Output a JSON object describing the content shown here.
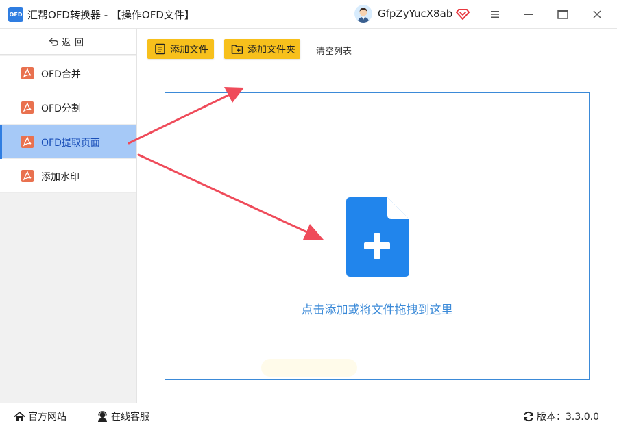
{
  "window": {
    "logo_text": "OFD",
    "title": "汇帮OFD转换器 - 【操作OFD文件】",
    "user_name": "GfpZyYucX8ab"
  },
  "colors": {
    "accent": "#2f7de1",
    "active_nav_bg": "#a6c9f7",
    "toolbar_button": "#f7c01c",
    "dropzone_border": "#3b8ad8",
    "arrow": "#ef4b5a",
    "nav_icon": "#e9714f"
  },
  "sidebar": {
    "back_label": "返回",
    "items": [
      {
        "label": "OFD合并",
        "icon": "pdf-icon",
        "active": false
      },
      {
        "label": "OFD分割",
        "icon": "pdf-icon",
        "active": false
      },
      {
        "label": "OFD提取页面",
        "icon": "pdf-icon",
        "active": true
      },
      {
        "label": "添加水印",
        "icon": "pdf-icon",
        "active": false
      }
    ]
  },
  "toolbar": {
    "add_file_label": "添加文件",
    "add_folder_label": "添加文件夹",
    "clear_list_label": "清空列表"
  },
  "dropzone": {
    "hint": "点击添加或将文件拖拽到这里",
    "icon": "file-add-icon"
  },
  "statusbar": {
    "website_label": "官方网站",
    "support_label": "在线客服",
    "version_label": "版本：3.3.0.0"
  }
}
